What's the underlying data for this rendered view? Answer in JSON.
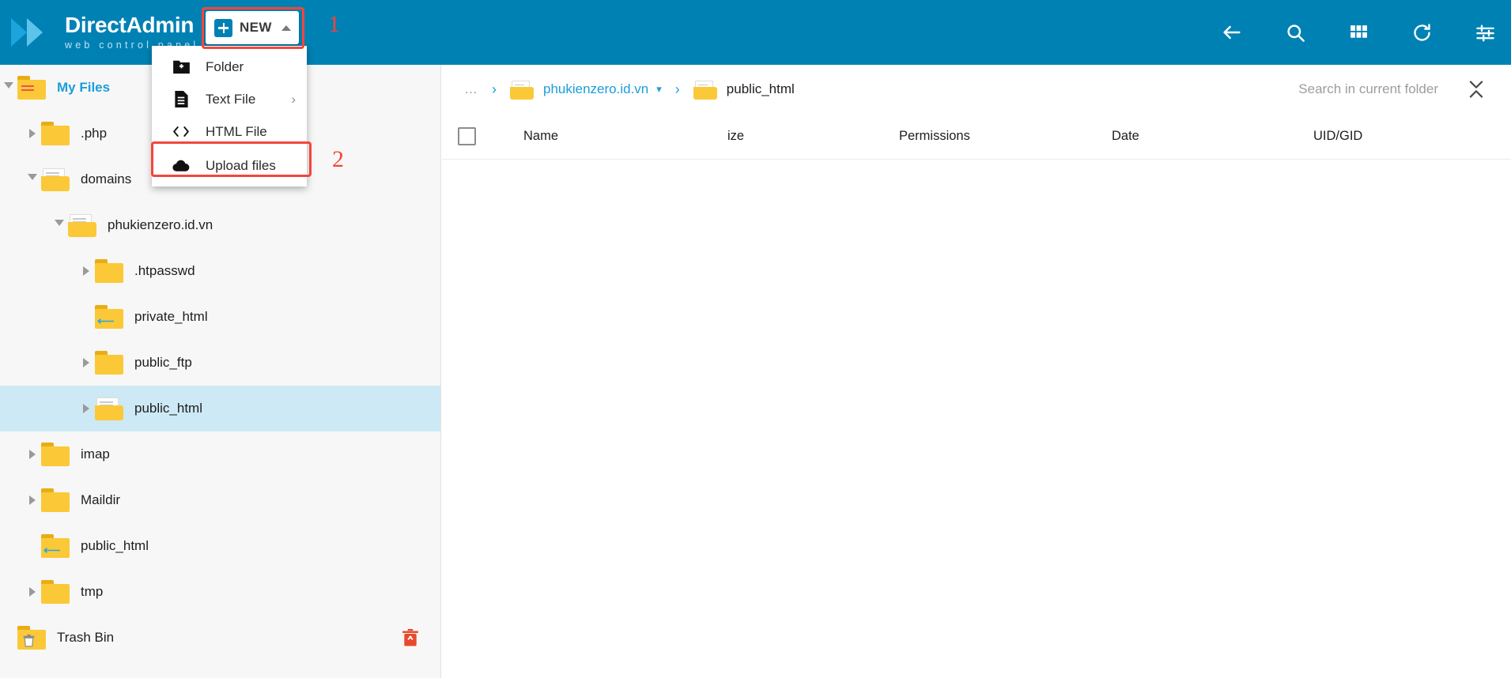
{
  "brand": {
    "name_part1": "Direct",
    "name_part2": "Admin",
    "tagline": "web control panel"
  },
  "toolbar": {
    "new_button_label": "NEW",
    "icons": [
      {
        "name": "back-arrow-icon",
        "glyph": "back"
      },
      {
        "name": "search-icon",
        "glyph": "search"
      },
      {
        "name": "apps-grid-icon",
        "glyph": "grid"
      },
      {
        "name": "refresh-icon",
        "glyph": "refresh"
      },
      {
        "name": "settings-sliders-icon",
        "glyph": "sliders"
      }
    ]
  },
  "annotations": [
    {
      "id": "1",
      "label": "1",
      "target": "new-button"
    },
    {
      "id": "2",
      "label": "2",
      "target": "upload-files-menu-item"
    }
  ],
  "dropdown": {
    "items": [
      {
        "label": "Folder",
        "icon": "folder-plus-icon",
        "submenu": false,
        "highlighted": false
      },
      {
        "label": "Text File",
        "icon": "text-file-icon",
        "submenu": true,
        "submenu_glyph": "›",
        "highlighted": false
      },
      {
        "label": "HTML File",
        "icon": "code-brackets-icon",
        "submenu": false,
        "highlighted": false
      },
      {
        "label": "Upload files",
        "icon": "cloud-upload-icon",
        "submenu": false,
        "highlighted": true
      }
    ]
  },
  "sidebar": {
    "items": [
      {
        "label": "My Files",
        "indent": 0,
        "arrow": "open",
        "icon": "folder-lines",
        "selected": false,
        "accent": true
      },
      {
        "label": ".php",
        "indent": 1,
        "arrow": "closed",
        "icon": "folder",
        "selected": false,
        "accent": false
      },
      {
        "label": "domains",
        "indent": 1,
        "arrow": "open",
        "icon": "folder-open",
        "selected": false,
        "accent": false
      },
      {
        "label": "phukienzero.id.vn",
        "indent": 2,
        "arrow": "open",
        "icon": "folder-open",
        "selected": false,
        "accent": false
      },
      {
        "label": ".htpasswd",
        "indent": 3,
        "arrow": "closed",
        "icon": "folder",
        "selected": false,
        "accent": false
      },
      {
        "label": "private_html",
        "indent": 3,
        "arrow": "none",
        "icon": "folder-link",
        "selected": false,
        "accent": false
      },
      {
        "label": "public_ftp",
        "indent": 3,
        "arrow": "closed",
        "icon": "folder",
        "selected": false,
        "accent": false
      },
      {
        "label": "public_html",
        "indent": 3,
        "arrow": "closed",
        "icon": "folder-open",
        "selected": true,
        "accent": false
      },
      {
        "label": "imap",
        "indent": 1,
        "arrow": "closed",
        "icon": "folder",
        "selected": false,
        "accent": false
      },
      {
        "label": "Maildir",
        "indent": 1,
        "arrow": "closed",
        "icon": "folder",
        "selected": false,
        "accent": false
      },
      {
        "label": "public_html",
        "indent": 1,
        "arrow": "none",
        "icon": "folder-link",
        "selected": false,
        "accent": false
      },
      {
        "label": "tmp",
        "indent": 1,
        "arrow": "closed",
        "icon": "folder",
        "selected": false,
        "accent": false
      },
      {
        "label": "Trash Bin",
        "indent": 0,
        "arrow": "none",
        "icon": "folder-trash",
        "selected": false,
        "accent": false,
        "trash_action": true
      }
    ]
  },
  "breadcrumb": {
    "items": [
      {
        "label": "…",
        "type": "ellipsis",
        "icon": false,
        "caret": false
      },
      {
        "label": "phukienzero.id.vn",
        "type": "link",
        "icon": true,
        "caret": true
      },
      {
        "label": "public_html",
        "type": "current",
        "icon": true,
        "caret": false
      }
    ],
    "separator": "›"
  },
  "search": {
    "placeholder": "Search in current folder",
    "value": ""
  },
  "table": {
    "columns": [
      {
        "label": "Name"
      },
      {
        "label": "ize"
      },
      {
        "label": "Permissions"
      },
      {
        "label": "Date"
      },
      {
        "label": "UID/GID"
      }
    ],
    "rows": []
  },
  "colors": {
    "brand_blue": "#0081b4",
    "link_blue": "#1b9ddb",
    "selection_blue": "#cde9f5",
    "annotation_red": "#f4463b",
    "folder_yellow": "#fbc937"
  }
}
